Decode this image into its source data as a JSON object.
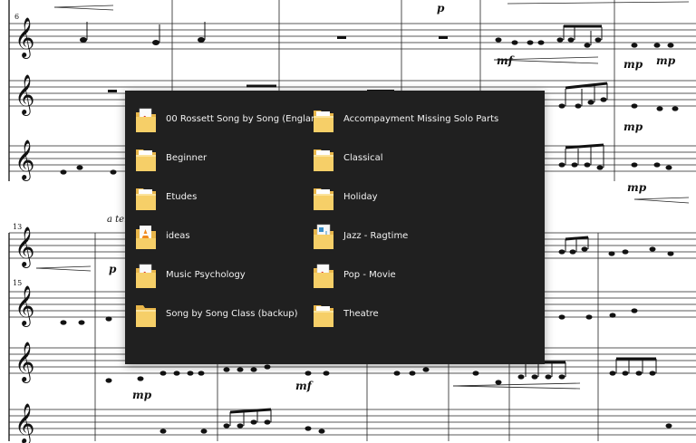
{
  "score": {
    "measure_numbers": [
      "6",
      "13",
      "15"
    ],
    "tempo_marking": "a tem",
    "dynamics": [
      "p",
      "mf",
      "mp",
      "mp",
      "mp",
      "mp",
      "p",
      "mp",
      "mf",
      "mp"
    ]
  },
  "popup": {
    "folders": [
      {
        "label": "00 Rossett Song by Song (England)",
        "icon": "folder-with-pdf-icon"
      },
      {
        "label": "Accompayment Missing Solo Parts",
        "icon": "folder-icon"
      },
      {
        "label": "Beginner",
        "icon": "folder-icon"
      },
      {
        "label": "Classical",
        "icon": "folder-icon"
      },
      {
        "label": "Etudes",
        "icon": "folder-icon"
      },
      {
        "label": "Holiday",
        "icon": "folder-icon"
      },
      {
        "label": "ideas",
        "icon": "folder-with-vlc-icon"
      },
      {
        "label": "Jazz - Ragtime",
        "icon": "folder-with-music-icon"
      },
      {
        "label": "Music Psychology",
        "icon": "folder-with-pdf-icon"
      },
      {
        "label": "Pop - Movie",
        "icon": "folder-with-pdf-icon"
      },
      {
        "label": "Song by Song Class (backup)",
        "icon": "folder-icon"
      },
      {
        "label": "Theatre",
        "icon": "folder-icon"
      }
    ]
  }
}
